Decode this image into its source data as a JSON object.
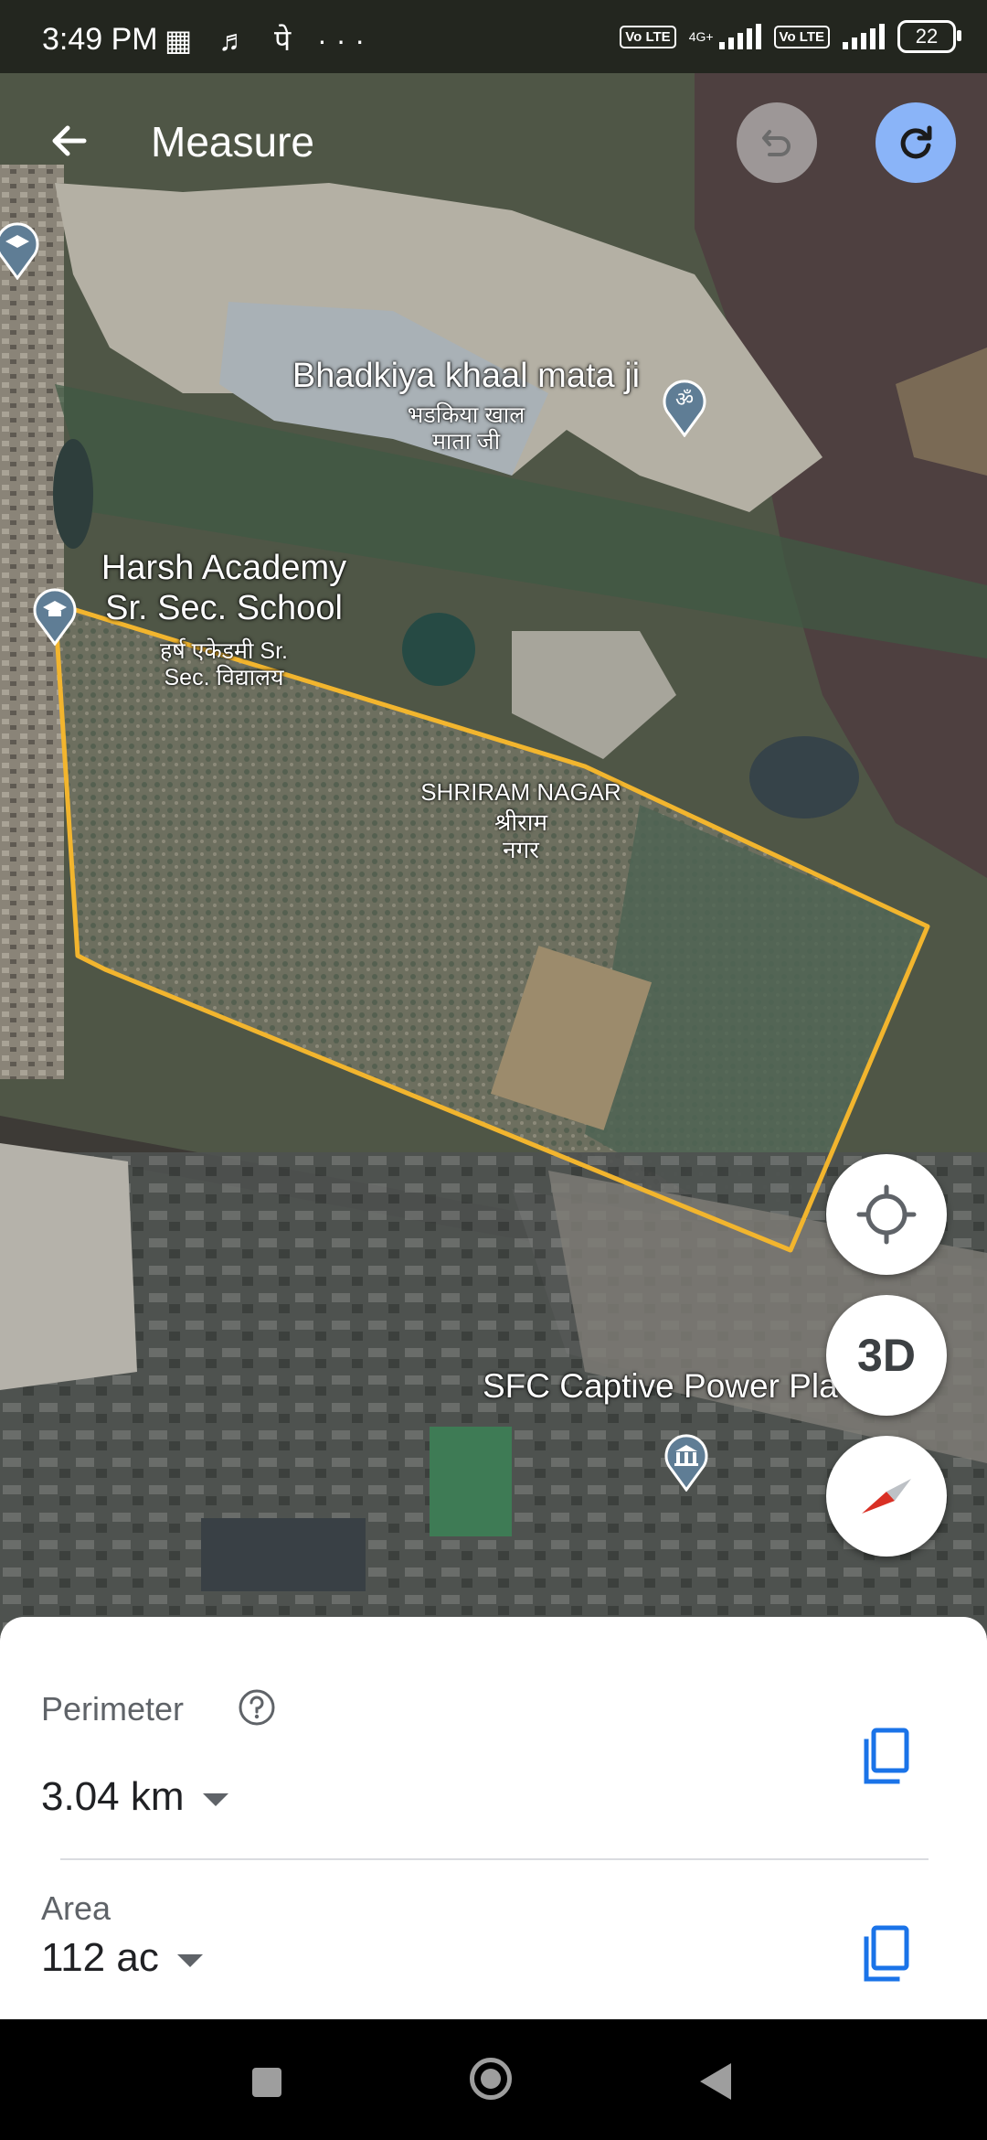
{
  "status_bar": {
    "time": "3:49 PM",
    "notification_icons": "▦ ♬ पे  ···",
    "sim1_label": "Vo LTE",
    "sim1_net": "4G+",
    "sim2_label": "Vo LTE",
    "battery": "22"
  },
  "app_bar": {
    "title": "Measure",
    "back_icon": "arrow-left",
    "undo_icon": "undo",
    "redo_icon": "redo"
  },
  "map": {
    "labels": {
      "temple_en": "Bhadkiya khaal mata ji",
      "temple_hi": "भडकिया खाल\nमाता जी",
      "school_en": "Harsh Academy\nSr. Sec. School",
      "school_hi": "हर्ष एकेडमी Sr.\nSec. विद्यालय",
      "area_en": "SHRIRAM NAGAR",
      "area_hi": "श्रीराम\nनगर",
      "plant_en": "SFC Captive Power Pla"
    },
    "polygon_color": "#f2b52e"
  },
  "fabs": {
    "locate_icon": "my-location",
    "three_d_label": "3D",
    "compass_icon": "compass"
  },
  "measurements": {
    "perimeter_label": "Perimeter",
    "perimeter_value": "3.04 km",
    "area_label": "Area",
    "area_value": "112 ac"
  },
  "colors": {
    "accent_blue": "#1a73e8",
    "redo_button": "#8ab4f8",
    "polygon": "#f2b52e"
  }
}
